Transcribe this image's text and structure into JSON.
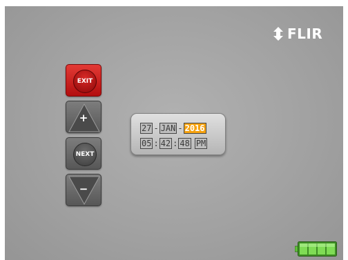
{
  "brand": {
    "name": "FLIR",
    "icon": "flir-logo-icon"
  },
  "buttons": {
    "exit_label": "EXIT",
    "up_symbol": "+",
    "next_label": "NEXT",
    "down_symbol": "−"
  },
  "datetime": {
    "day": "27",
    "month": "JAN",
    "year": "2016",
    "date_separator": "-",
    "hour": "05",
    "minute": "42",
    "second": "48",
    "time_separator": ":",
    "ampm": "PM",
    "selected_field": "year"
  },
  "battery": {
    "icon": "battery-icon",
    "level": 1.0
  },
  "colors": {
    "accent_red": "#c41414",
    "selection_orange": "#f6a20f",
    "battery_green": "#62c73a"
  }
}
